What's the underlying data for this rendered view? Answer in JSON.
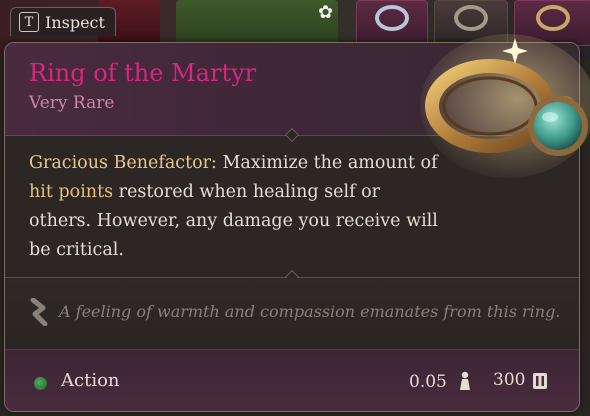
{
  "inspect": {
    "key": "T",
    "label": "Inspect"
  },
  "item": {
    "name": "Ring of the Martyr",
    "rarity": "Very Rare",
    "description": {
      "lead": "Gracious Benefactor:",
      "text_before": " Maximize the amount of ",
      "highlight": "hit points",
      "text_after": " restored when healing self or others. However, any damage you receive will be critical."
    },
    "flavor_text": "A feeling of warmth and compassion emanates from this ring.",
    "action_type": "Action",
    "weight": "0.05",
    "price": "300"
  },
  "colors": {
    "name": "#d9267f",
    "rarity": "#c987aa",
    "highlight": "#e3c27b",
    "action_dot": "#3e9a52"
  },
  "icons": {
    "weight": "weight-icon",
    "price": "gold-coin-icon",
    "flavor": "feather-scroll-icon",
    "ring": "ring-of-the-martyr-icon",
    "flower": "flower-icon"
  }
}
